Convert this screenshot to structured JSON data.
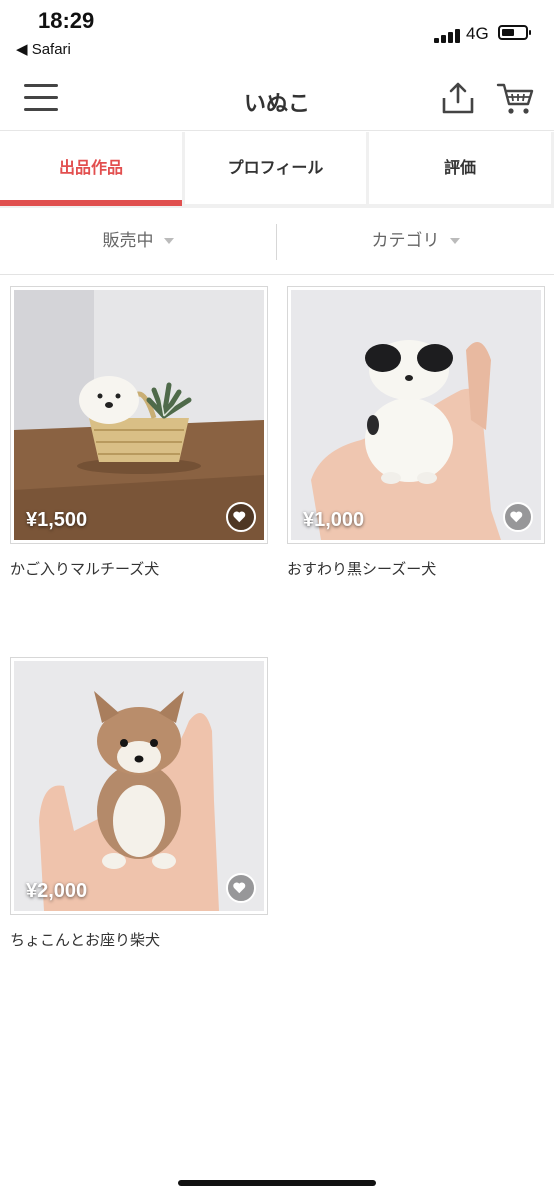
{
  "status_bar": {
    "time": "18:29",
    "back_label": "◀ Safari",
    "network": "4G"
  },
  "header": {
    "title": "いぬこ",
    "icons": [
      "menu-icon",
      "share-icon",
      "cart-icon"
    ]
  },
  "tabs": [
    {
      "label": "出品作品",
      "active": true
    },
    {
      "label": "プロフィール",
      "active": false
    },
    {
      "label": "評価",
      "active": false
    }
  ],
  "filters": {
    "status_label": "販売中",
    "category_label": "カテゴリ"
  },
  "products": [
    {
      "price": "¥1,500",
      "name": "かご入りマルチーズ犬"
    },
    {
      "price": "¥1,000",
      "name": "おすわり黒シーズー犬"
    },
    {
      "price": "¥2,000",
      "name": "ちょこんとお座り柴犬"
    }
  ],
  "colors": {
    "accent": "#e0504f",
    "tab_background": "#f0f0f0"
  }
}
